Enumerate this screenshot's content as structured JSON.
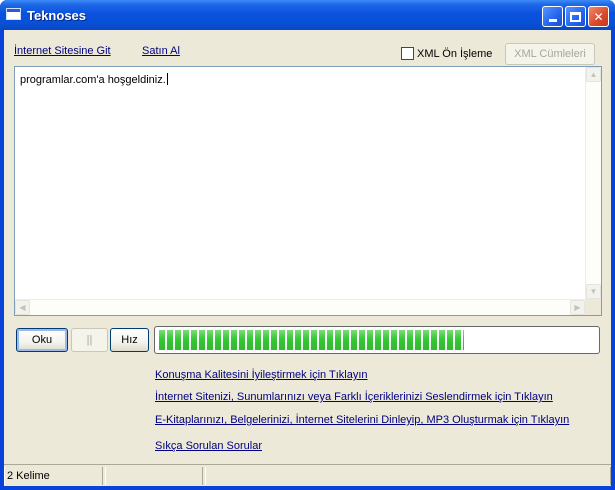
{
  "window": {
    "title": "Teknoses",
    "icon": "window-app-icon",
    "controls": [
      "minimize-icon",
      "maximize-icon",
      "close-icon"
    ]
  },
  "toolbar": {
    "link_website": "İnternet Sitesine Git",
    "link_buy": "Satın Al",
    "xml_preprocess_label": "XML Ön İşleme",
    "xml_preprocess_checked": false,
    "xml_sentences_button": "XML Cümleleri"
  },
  "editor": {
    "text": "programlar.com'a hoşgeldiniz."
  },
  "controls": {
    "read_button": "Oku",
    "pause_button": "||",
    "speed_button": "Hız",
    "progress_fraction": 0.7
  },
  "help_links": [
    "Konuşma Kalitesini İyileştirmek için Tıklayın",
    "İnternet Sitenizi, Sunumlarınızı veya Farklı İçeriklerinizi Seslendirmek için Tıklayın",
    "E-Kitaplarınızı, Belgelerinizi, İnternet Sitelerini Dinleyip, MP3 Oluşturmak için Tıklayın",
    "Sıkça Sorulan Sorular"
  ],
  "status": {
    "word_count": "2 Kelime",
    "pane2": "",
    "pane3": ""
  },
  "colors": {
    "link": "#000080",
    "progress": "#34c934",
    "titlebar": "#0a52de"
  }
}
